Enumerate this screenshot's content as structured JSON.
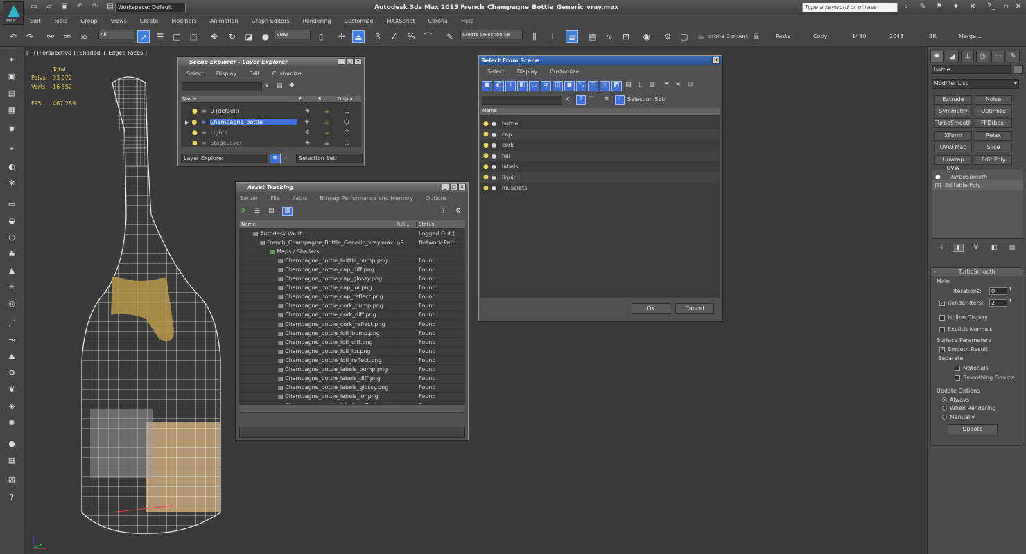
{
  "title_bar": {
    "app_title": "Autodesk 3ds Max  2015    French_Champagne_Bottle_Generic_vray.max",
    "workspace": "Workspace: Default",
    "search_placeholder": "Type a keyword or phrase",
    "logo_text": "MAX"
  },
  "menu": [
    "Edit",
    "Tools",
    "Group",
    "Views",
    "Create",
    "Modifiers",
    "Animation",
    "Graph Editors",
    "Rendering",
    "Customize",
    "MAXScript",
    "Corona",
    "Help"
  ],
  "toolbar": {
    "selection_filter": "All",
    "ref_coord": "View",
    "selection_set_placeholder": "Create Selection Se",
    "corona_convert": "orona Convert",
    "paste": "Paste",
    "copy": "Copy",
    "res1": "1480",
    "res2": "2048",
    "br": "BR",
    "merge": "Merge...",
    "snap_label": "3",
    "angle_label": "%"
  },
  "viewport": {
    "label": "[+] [Perspective ] [Shaded + Edged Faces ]",
    "stats": {
      "total_label": "Total",
      "polys_label": "Polys:",
      "polys": "33 072",
      "verts_label": "Verts:",
      "verts": "16 552",
      "fps_label": "FPS:",
      "fps": "467.289"
    }
  },
  "scene_explorer": {
    "title": "Scene Explorer - Layer Explorer",
    "menu": [
      "Select",
      "Display",
      "Edit",
      "Customize"
    ],
    "headers": [
      "Name",
      "Fr...",
      "R...",
      "Displa..."
    ],
    "rows": [
      "0 (default)",
      "Champagne_bottle",
      "Lights",
      "StageLayer"
    ],
    "footer_mode": "Layer Explorer",
    "footer_selset": "Selection Set:"
  },
  "asset_tracking": {
    "title": "Asset Tracking",
    "menu": [
      "Server",
      "File",
      "Paths",
      "Bitmap Performance and Memory",
      "Options"
    ],
    "headers": [
      "Name",
      "Full...",
      "Status"
    ],
    "rows": [
      {
        "name": "Autodesk Vault",
        "full": "",
        "status": "Logged Out (..."
      },
      {
        "name": "French_Champagne_Bottle_Generic_vray.max",
        "full": "\\\\R...",
        "status": "Network Path"
      },
      {
        "name": "Maps / Shaders",
        "full": "",
        "status": ""
      },
      {
        "name": "Champagne_bottle_bottle_bump.png",
        "full": "",
        "status": "Found"
      },
      {
        "name": "Champagne_bottle_cap_diff.png",
        "full": "",
        "status": "Found"
      },
      {
        "name": "Champagne_bottle_cap_glossy.png",
        "full": "",
        "status": "Found"
      },
      {
        "name": "Champagne_bottle_cap_ior.png",
        "full": "",
        "status": "Found"
      },
      {
        "name": "Champagne_bottle_cap_reflect.png",
        "full": "",
        "status": "Found"
      },
      {
        "name": "Champagne_bottle_cork_bump.png",
        "full": "",
        "status": "Found"
      },
      {
        "name": "Champagne_bottle_cork_diff.png",
        "full": "",
        "status": "Found"
      },
      {
        "name": "Champagne_bottle_cork_reflect.png",
        "full": "",
        "status": "Found"
      },
      {
        "name": "Champagne_bottle_foil_bump.png",
        "full": "",
        "status": "Found"
      },
      {
        "name": "Champagne_bottle_foil_diff.png",
        "full": "",
        "status": "Found"
      },
      {
        "name": "Champagne_bottle_foil_ior.png",
        "full": "",
        "status": "Found"
      },
      {
        "name": "Champagne_bottle_foil_reflect.png",
        "full": "",
        "status": "Found"
      },
      {
        "name": "Champagne_bottle_labels_bump.png",
        "full": "",
        "status": "Found"
      },
      {
        "name": "Champagne_bottle_labels_diff.png",
        "full": "",
        "status": "Found"
      },
      {
        "name": "Champagne_bottle_labels_glossy.png",
        "full": "",
        "status": "Found"
      },
      {
        "name": "Champagne_bottle_labels_ior.png",
        "full": "",
        "status": "Found"
      },
      {
        "name": "Champagne_bottle_labels_reflect.png",
        "full": "",
        "status": "Found"
      }
    ]
  },
  "select_from_scene": {
    "title": "Select From Scene",
    "menu": [
      "Select",
      "Display",
      "Customize"
    ],
    "selset": "Selection Set:",
    "header": "Name",
    "rows": [
      "bottle",
      "cap",
      "cork",
      "foil",
      "labels",
      "liquid",
      "muselets"
    ],
    "ok": "OK",
    "cancel": "Cancel"
  },
  "command_panel": {
    "object_name": "bottle",
    "modifier_list": "Modifier List",
    "buttons": [
      "Extrude",
      "Noise",
      "Symmetry",
      "Optimize",
      "TurboSmooth",
      "FFD(box)",
      "XForm",
      "Relax",
      "UVW Map",
      "Slice",
      "Unwrap UVW",
      "Edit Poly"
    ],
    "stack": [
      "TurboSmooth",
      "Editable Poly"
    ],
    "rollout_title": "TurboSmooth",
    "main_label": "Main",
    "iterations_label": "Iterations:",
    "iterations": "0",
    "render_iters_label": "Render Iters:",
    "render_iters": "2",
    "isoline": "Isoline Display",
    "explicit_normals": "Explicit Normals",
    "surface_params": "Surface Parameters",
    "smooth_result": "Smooth Result",
    "separate": "Separate",
    "materials": "Materials",
    "smoothing_groups": "Smoothing Groups",
    "update_options": "Update Options",
    "always": "Always",
    "when_rendering": "When Rendering",
    "manually": "Manually",
    "update": "Update"
  },
  "colors": {
    "accent": "#3d6fd6",
    "stats": "#e6d25a",
    "viewport_bg": "#3a3a3a"
  }
}
